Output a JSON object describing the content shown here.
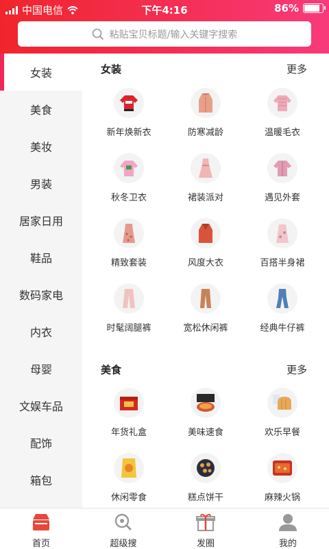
{
  "status_bar": {
    "carrier": "中国电信",
    "time": "下午4:16",
    "battery": "86%"
  },
  "search": {
    "placeholder": "粘贴宝贝标题/输入关键字搜索"
  },
  "sidebar": {
    "items": [
      {
        "label": "女装",
        "active": true
      },
      {
        "label": "美食"
      },
      {
        "label": "美妆"
      },
      {
        "label": "男装"
      },
      {
        "label": "居家日用"
      },
      {
        "label": "鞋品"
      },
      {
        "label": "数码家电"
      },
      {
        "label": "内衣"
      },
      {
        "label": "母婴"
      },
      {
        "label": "文娱车品"
      },
      {
        "label": "配饰"
      },
      {
        "label": "箱包"
      }
    ]
  },
  "sections": [
    {
      "title": "女装",
      "more": "更多",
      "items": [
        {
          "label": "新年焕新衣",
          "icon": "red-sweater-icon"
        },
        {
          "label": "防寒减龄",
          "icon": "pink-coat-icon"
        },
        {
          "label": "温暖毛衣",
          "icon": "pink-knit-sweater-icon"
        },
        {
          "label": "秋冬卫衣",
          "icon": "pink-sweatshirt-icon"
        },
        {
          "label": "裙装派对",
          "icon": "pink-dress-icon"
        },
        {
          "label": "遇见外套",
          "icon": "pink-jacket-icon"
        },
        {
          "label": "精致套装",
          "icon": "floral-dress-icon"
        },
        {
          "label": "风度大衣",
          "icon": "red-overcoat-icon"
        },
        {
          "label": "百搭半身裙",
          "icon": "pink-skirt-icon"
        },
        {
          "label": "时髦阔腿裤",
          "icon": "pink-wide-pants-icon"
        },
        {
          "label": "宽松休闲裤",
          "icon": "brown-pants-icon"
        },
        {
          "label": "经典牛仔裤",
          "icon": "jeans-icon"
        }
      ]
    },
    {
      "title": "美食",
      "more": "更多",
      "items": [
        {
          "label": "年货礼盒",
          "icon": "gift-box-icon"
        },
        {
          "label": "美味速食",
          "icon": "instant-food-icon"
        },
        {
          "label": "欢乐早餐",
          "icon": "bread-icon"
        },
        {
          "label": "休闲零食",
          "icon": "snack-bag-icon"
        },
        {
          "label": "糕点饼干",
          "icon": "cookies-icon"
        },
        {
          "label": "麻辣火锅",
          "icon": "hotpot-icon"
        }
      ]
    }
  ],
  "tabbar": {
    "items": [
      {
        "label": "首页",
        "icon": "home-store-icon",
        "color": "#e8473a"
      },
      {
        "label": "超级搜",
        "icon": "search-icon",
        "color": "#999999"
      },
      {
        "label": "发圈",
        "icon": "gift-icon",
        "color": "#999999"
      },
      {
        "label": "我的",
        "icon": "user-icon",
        "color": "#999999"
      }
    ]
  },
  "colors": {
    "accent": "#f0265a",
    "header_start": "#f0252c",
    "header_end": "#f83a7a"
  }
}
